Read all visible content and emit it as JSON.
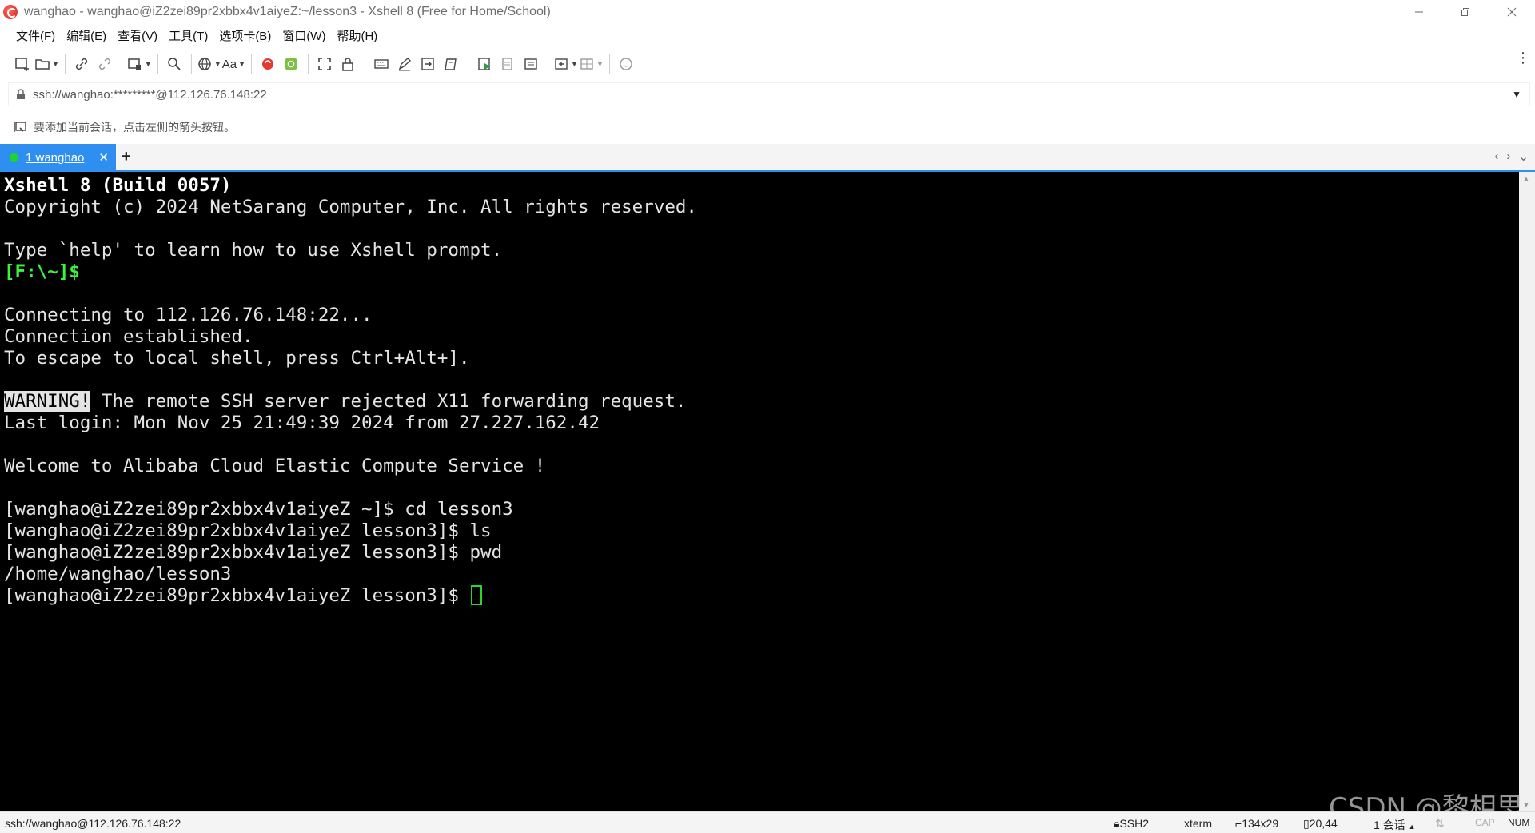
{
  "window": {
    "title": "wanghao - wanghao@iZ2zei89pr2xbbx4v1aiyeZ:~/lesson3 - Xshell 8 (Free for Home/School)"
  },
  "menu": {
    "items": [
      "文件(F)",
      "编辑(E)",
      "查看(V)",
      "工具(T)",
      "选项卡(B)",
      "窗口(W)",
      "帮助(H)"
    ]
  },
  "toolbar": {
    "font_button_label": "Aa"
  },
  "address": {
    "value": "ssh://wanghao:*********@112.126.76.148:22"
  },
  "hint": {
    "text": "要添加当前会话，点击左侧的箭头按钮。"
  },
  "tabs": {
    "active_label": "1 wanghao",
    "close_glyph": "✕",
    "add_glyph": "+"
  },
  "terminal": {
    "lines": [
      "Xshell 8 (Build 0057)",
      "Copyright (c) 2024 NetSarang Computer, Inc. All rights reserved.",
      "",
      "Type `help' to learn how to use Xshell prompt.",
      "[F:\\~]$",
      "",
      "Connecting to 112.126.76.148:22...",
      "Connection established.",
      "To escape to local shell, press Ctrl+Alt+].",
      "",
      "WARNING!",
      " The remote SSH server rejected X11 forwarding request.",
      "Last login: Mon Nov 25 21:49:39 2024 from 27.227.162.42",
      "",
      "Welcome to Alibaba Cloud Elastic Compute Service !",
      "",
      "[wanghao@iZ2zei89pr2xbbx4v1aiyeZ ~]$ cd lesson3",
      "[wanghao@iZ2zei89pr2xbbx4v1aiyeZ lesson3]$ ls",
      "[wanghao@iZ2zei89pr2xbbx4v1aiyeZ lesson3]$ pwd",
      "/home/wanghao/lesson3",
      "[wanghao@iZ2zei89pr2xbbx4v1aiyeZ lesson3]$ "
    ]
  },
  "status": {
    "connection": "ssh://wanghao@112.126.76.148:22",
    "protocol": "SSH2",
    "terminal_type": "xterm",
    "size": "134x29",
    "cursor_pos": "20,44",
    "sessions": "1 会话",
    "cap": "CAP",
    "num": "NUM"
  },
  "watermark": "CSDN @黎相思",
  "colors": {
    "accent": "#2f8ff0",
    "terminal_bg": "#000000",
    "prompt_green": "#3df23d"
  }
}
